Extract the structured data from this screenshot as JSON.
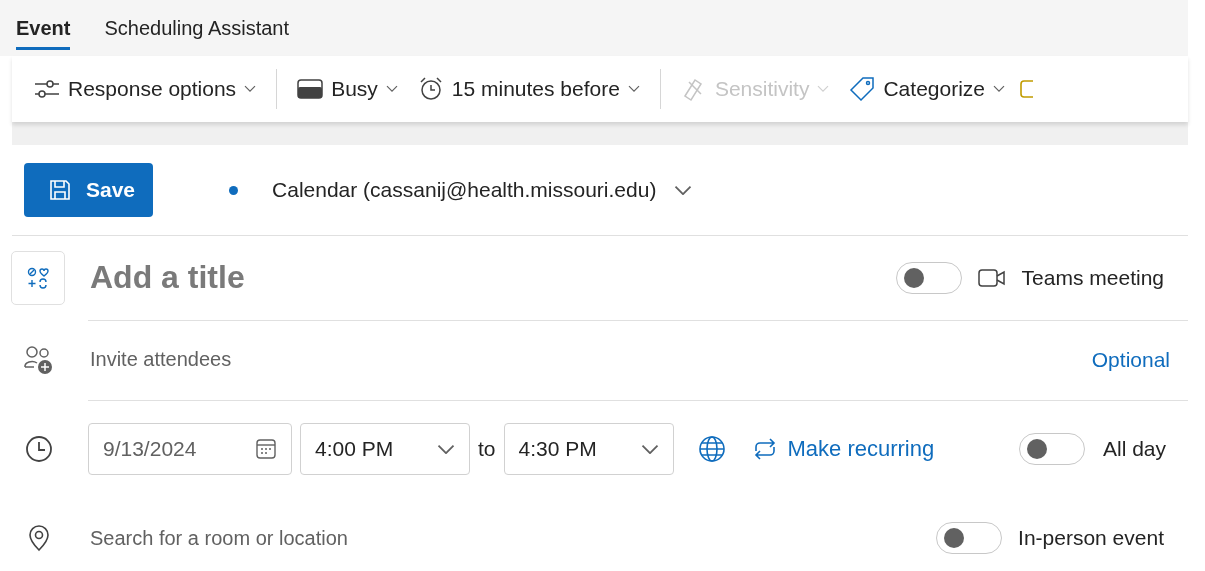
{
  "tabs": [
    {
      "label": "Event",
      "selected": true
    },
    {
      "label": "Scheduling Assistant",
      "selected": false
    }
  ],
  "toolbar": [
    {
      "kind": "response",
      "label": "Response options",
      "disabled": false
    },
    {
      "kind": "divider"
    },
    {
      "kind": "busy",
      "label": "Busy",
      "disabled": false
    },
    {
      "kind": "alarm",
      "label": "15 minutes before",
      "disabled": false
    },
    {
      "kind": "divider"
    },
    {
      "kind": "sensitivity",
      "label": "Sensitivity",
      "disabled": true
    },
    {
      "kind": "categorize",
      "label": "Categorize",
      "disabled": false
    },
    {
      "kind": "partial"
    }
  ],
  "save_button": {
    "label": "Save"
  },
  "calendar": {
    "label": "Calendar (cassanij@health.missouri.edu)",
    "color": "#0f6cbd"
  },
  "title": {
    "placeholder": "Add a title"
  },
  "teams_meeting": {
    "label": "Teams meeting",
    "on": false
  },
  "attendees": {
    "placeholder": "Invite attendees",
    "optional_link": "Optional"
  },
  "time": {
    "date": "9/13/2024",
    "start": "4:00 PM",
    "separator": "to",
    "end": "4:30 PM",
    "recurring": "Make recurring",
    "all_day": {
      "label": "All day",
      "on": false
    }
  },
  "location": {
    "placeholder": "Search for a room or location",
    "in_person": {
      "label": "In-person event",
      "on": false
    }
  }
}
